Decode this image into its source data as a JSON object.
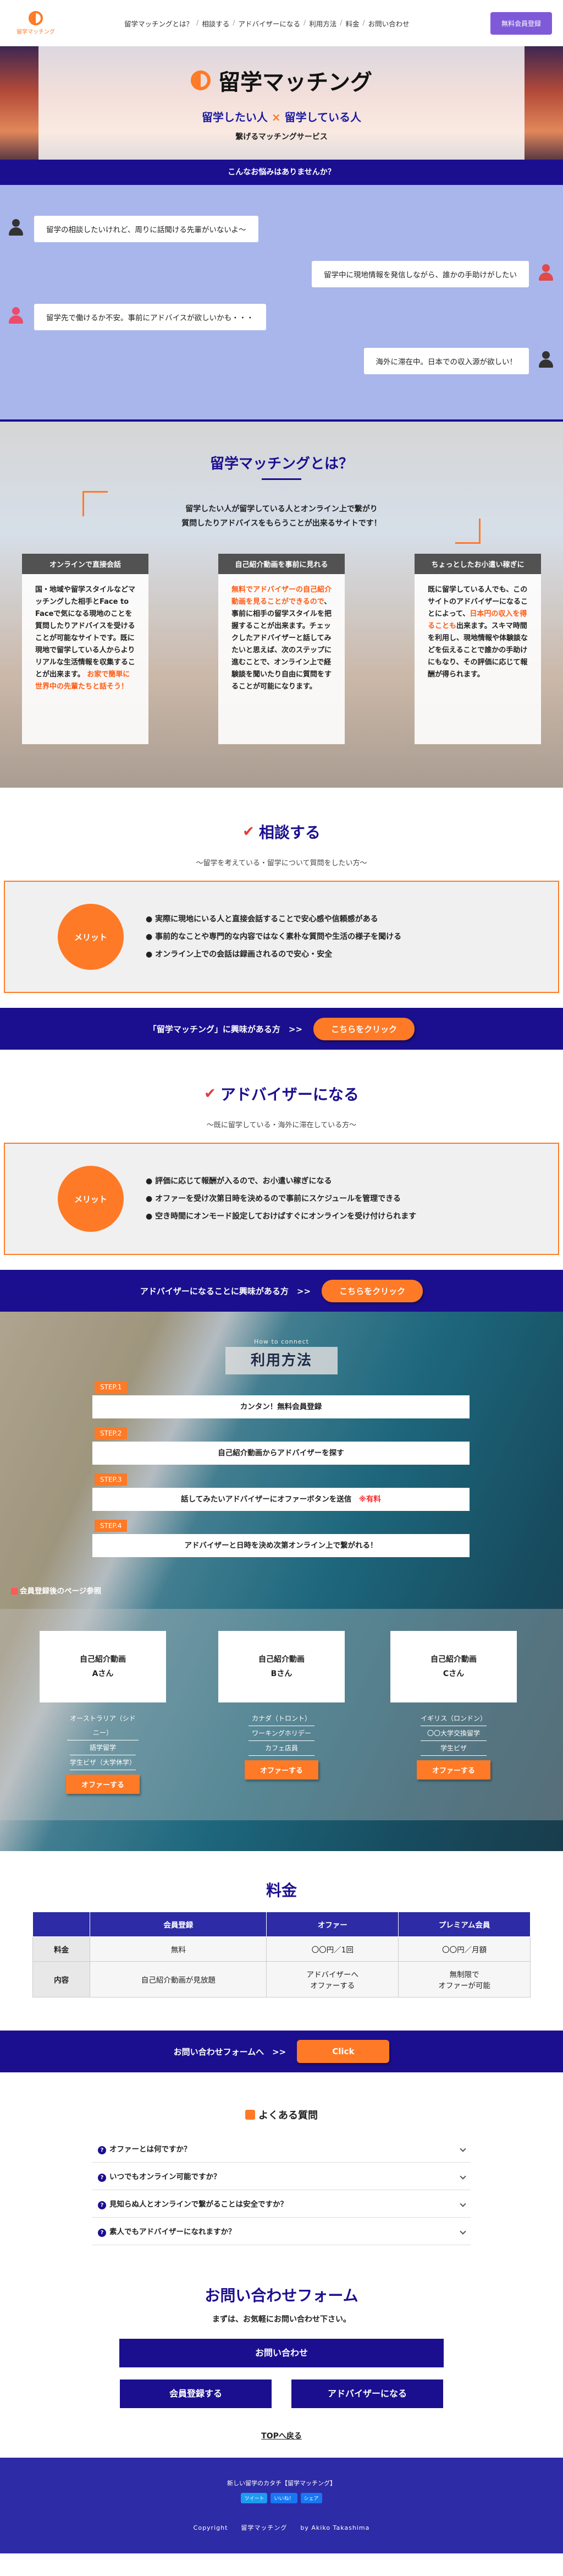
{
  "header": {
    "logo_text": "留学マッチング",
    "nav": [
      "留学マッチングとは？",
      "相談する",
      "アドバイザーになる",
      "利用方法",
      "料金",
      "お問い合わせ"
    ],
    "register_button": "無料会員登録"
  },
  "hero": {
    "title": "留学マッチング",
    "sub_left": "留学したい人",
    "sub_x": "×",
    "sub_right": "留学している人",
    "tagline": "繋げるマッチングサービス"
  },
  "worries": {
    "heading": "こんなお悩みはありませんか？",
    "items": [
      "留学の相談したいけれど、周りに話聞ける先輩がいないよ～",
      "留学中に現地情報を発信しながら、誰かの手助けがしたい",
      "留学先で働けるか不安。事前にアドバイスが欲しいかも・・・",
      "海外に滞在中。日本での収入源が欲しい！"
    ]
  },
  "whatis": {
    "title": "留学マッチングとは？",
    "desc1": "留学したい人が留学している人とオンライン上で繋がり",
    "desc2": "質問したりアドバイスをもらうことが出来るサイトです！",
    "cards": [
      {
        "head": "オンラインで直接会話",
        "body": "国・地域や留学スタイルなどマッチングした相手とFace to Faceで気になる現地のことを質問したりアドバイスを受けることが可能なサイトです。既に現地で留学している人からよりリアルな生活情報を収集することが出来ます。",
        "highlight": "お家で簡単に世界中の先輩たちと話そう！"
      },
      {
        "head": "自己紹介動画を事前に見れる",
        "highlight": "無料でアドバイザーの自己紹介動画を見ることができるので",
        "body": "、事前に相手の留学スタイルを把握することが出来ます。チェックしたアドバイザーと話してみたいと思えば、次のステップに進むことで、オンライン上で経験談を聞いたり自由に質問をすることが可能になります。"
      },
      {
        "head": "ちょっとしたお小遣い稼ぎに",
        "body1": "既に留学している人でも、このサイトのアドバイザーになることによって、",
        "highlight": "日本円の収入を得ることも",
        "body2": "出来ます。スキマ時間を利用し、現地情報や体験談などを伝えることで誰かの手助けにもなり、その評価に応じて報酬が得られます。"
      }
    ]
  },
  "consult": {
    "title": "相談する",
    "subtitle": "～留学を考えている・留学について質問をしたい方～",
    "merit_label": "メリット",
    "points": [
      "実際に現地にいる人と直接会話することで安心感や信頼感がある",
      "事前的なことや専門的な内容ではなく素朴な質問や生活の様子を聞ける",
      "オンライン上での会話は録画されるので安心・安全"
    ],
    "cta_text": "「留学マッチング」に興味がある方　>>",
    "cta_button": "こちらをクリック"
  },
  "advisor": {
    "title": "アドバイザーになる",
    "subtitle": "～既に留学している・海外に滞在している方～",
    "merit_label": "メリット",
    "points": [
      "評価に応じて報酬が入るので、お小遣い稼ぎになる",
      "オファーを受け次第日時を決めるので事前にスケジュールを管理できる",
      "空き時間にオンモード設定しておけばすぐにオンラインを受け付けられます"
    ],
    "cta_text": "アドバイザーになることに興味がある方　>>",
    "cta_button": "こちらをクリック"
  },
  "usage": {
    "howto": "How to connect",
    "title": "利用方法",
    "steps": [
      {
        "tag": "STEP.1",
        "text": "カンタン！無料会員登録",
        "note": ""
      },
      {
        "tag": "STEP.2",
        "text": "自己紹介動画からアドバイザーを探す",
        "note": ""
      },
      {
        "tag": "STEP.3",
        "text": "話してみたいアドバイザーにオファーボタンを送信　",
        "note": "※有料"
      },
      {
        "tag": "STEP.4",
        "text": "アドバイザーと日時を決め次第オンライン上で繋がれる！",
        "note": ""
      }
    ],
    "member_title": "会員登録後のページ参照",
    "members": [
      {
        "video": "自己紹介動画",
        "name": "Aさん",
        "country": "オーストラリア（シドニー）",
        "style": "語学留学",
        "status": "学生ビザ（大学休学）",
        "button": "オファーする"
      },
      {
        "video": "自己紹介動画",
        "name": "Bさん",
        "country": "カナダ（トロント）",
        "style": "ワーキングホリデー",
        "status": "カフェ店員",
        "button": "オファーする"
      },
      {
        "video": "自己紹介動画",
        "name": "Cさん",
        "country": "イギリス（ロンドン）",
        "style": "〇〇大学交換留学",
        "status": "学生ビザ",
        "button": "オファーする"
      }
    ]
  },
  "price": {
    "title": "料金",
    "headers": [
      "",
      "会員登録",
      "オファー",
      "プレミアム会員"
    ],
    "rows": [
      [
        "料金",
        "無料",
        "〇〇円／1回",
        "〇〇円／月額"
      ],
      [
        "内容",
        "自己紹介動画が見放題",
        "アドバイザーへ\nオファーする",
        "無制限で\nオファーが可能"
      ]
    ]
  },
  "contact_cta": {
    "text": "お問い合わせフォームへ　>>",
    "button": "Click"
  },
  "faq": {
    "title": "よくある質問",
    "items": [
      "オファーとは何ですか？",
      "いつでもオンライン可能ですか？",
      "見知らぬ人とオンラインで繋がることは安全ですか？",
      "素人でもアドバイザーになれますか？"
    ]
  },
  "contact": {
    "title": "お問い合わせフォーム",
    "desc": "まずは、お気軽にお問い合わせ下さい。",
    "buttons": [
      "お問い合わせ",
      "会員登録する",
      "アドバイザーになる"
    ],
    "totop": "TOPへ戻る"
  },
  "footer": {
    "line1": "新しい留学のカタチ【留学マッチング】",
    "social": [
      "ツイート",
      "いいね！",
      "シェア"
    ],
    "copyright": "Copyright　　留学マッチング　　by Akiko Takashima"
  }
}
